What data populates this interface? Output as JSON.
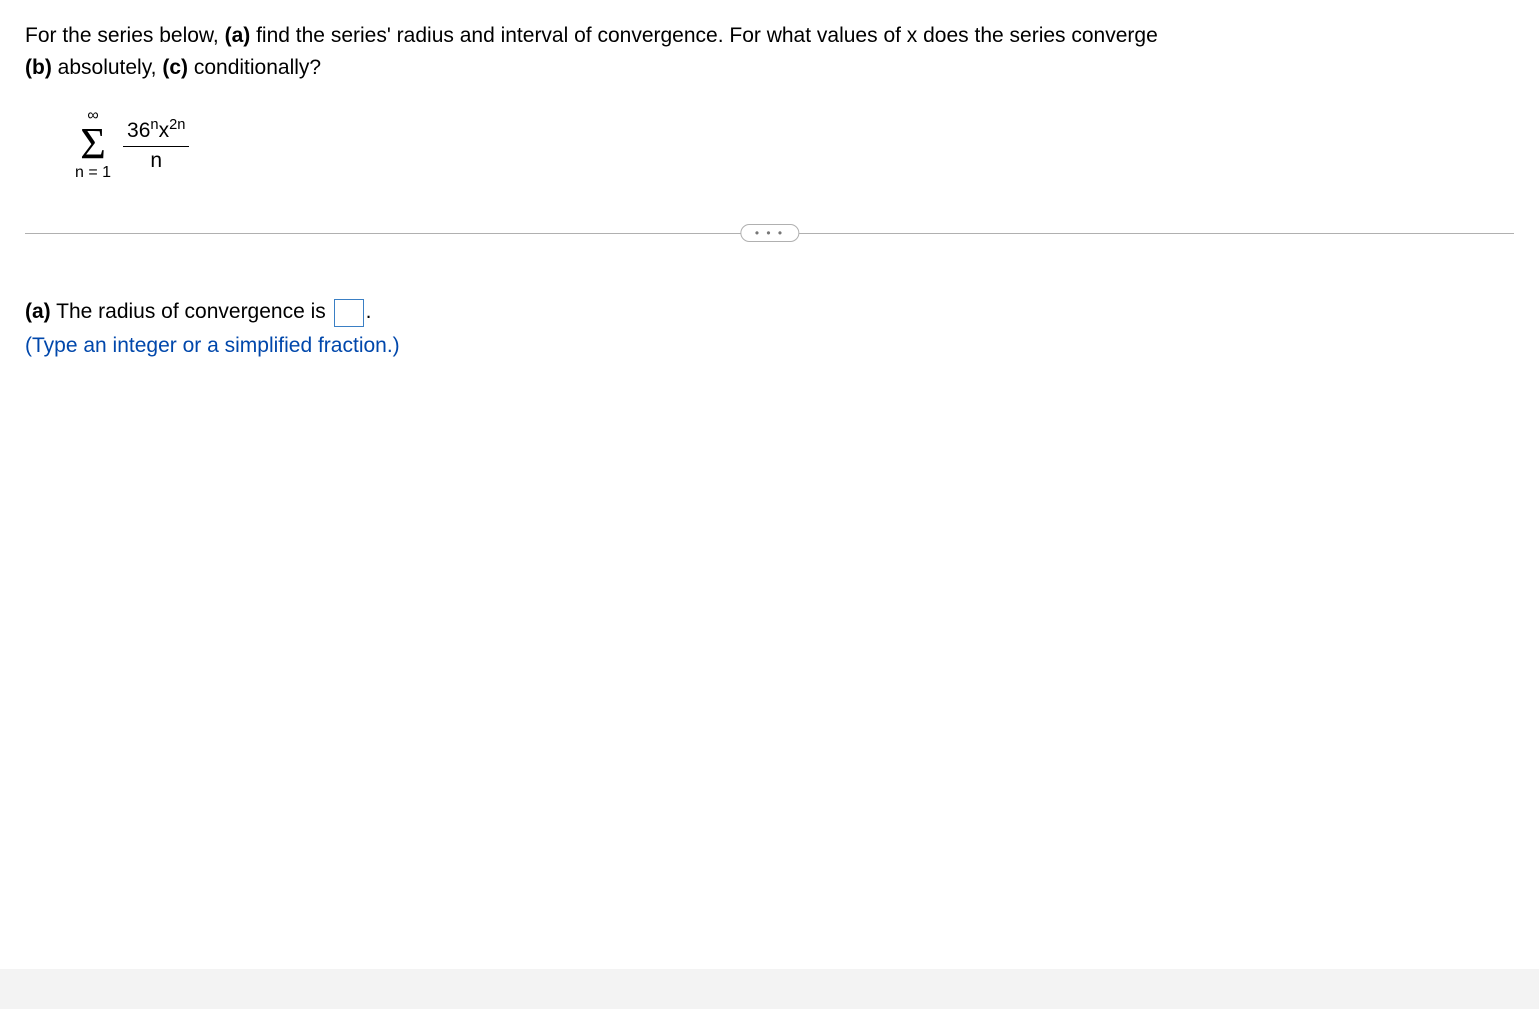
{
  "problem": {
    "intro": "For the series below, ",
    "part_a_bold": "(a)",
    "part_a_text": " find the series' radius and interval of convergence. For what values of x does the series converge ",
    "part_b_bold": "(b)",
    "part_b_text": " absolutely, ",
    "part_c_bold": "(c)",
    "part_c_text": " conditionally?"
  },
  "series": {
    "upper_limit": "∞",
    "sigma": "Σ",
    "lower_limit": "n = 1",
    "base1": "36",
    "exp1": "n",
    "var": "x",
    "exp2": "2n",
    "denominator": "n"
  },
  "divider": {
    "dots": "• • •"
  },
  "answer": {
    "part_label": "(a)",
    "prompt_before": " The radius of convergence is ",
    "prompt_after": ".",
    "input_value": "",
    "hint": "(Type an integer or a simplified fraction.)"
  }
}
